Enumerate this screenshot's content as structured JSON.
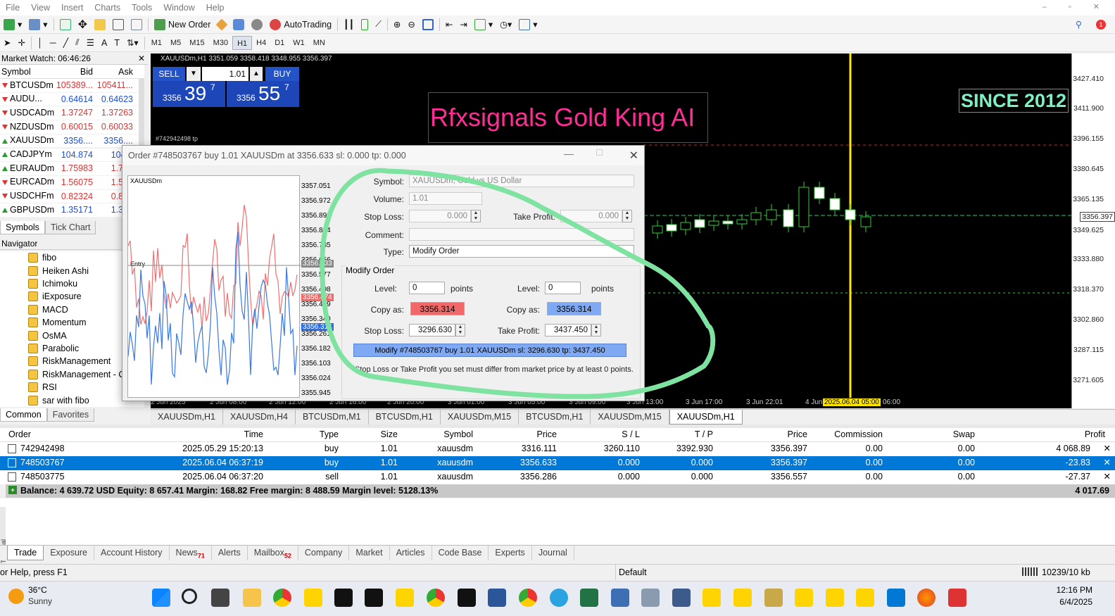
{
  "menu": [
    "File",
    "View",
    "Insert",
    "Charts",
    "Tools",
    "Window",
    "Help"
  ],
  "toolbar": {
    "new_order": "New Order",
    "autotrading": "AutoTrading"
  },
  "timeframes": [
    "M1",
    "M5",
    "M15",
    "M30",
    "H1",
    "H4",
    "D1",
    "W1",
    "MN"
  ],
  "active_timeframe": "H1",
  "market_watch": {
    "title": "Market Watch: 06:46:26",
    "cols": [
      "Symbol",
      "Bid",
      "Ask"
    ],
    "rows": [
      {
        "symbol": "BTCUSDm",
        "bid": "105389...",
        "ask": "105411...",
        "dir": "down",
        "color": "#d33"
      },
      {
        "symbol": "AUDU...",
        "bid": "0.64614",
        "ask": "0.64623",
        "dir": "down",
        "color": "#1a4fd6"
      },
      {
        "symbol": "USDCADm",
        "bid": "1.37247",
        "ask": "1.37263",
        "dir": "down",
        "color": "#d33"
      },
      {
        "symbol": "NZDUSDm",
        "bid": "0.60015",
        "ask": "0.60033",
        "dir": "down",
        "color": "#d33"
      },
      {
        "symbol": "XAUUSDm",
        "bid": "3356....",
        "ask": "3356....",
        "dir": "up",
        "color": "#1a4fd6"
      },
      {
        "symbol": "CADJPYm",
        "bid": "104.874",
        "ask": "104.9",
        "dir": "up",
        "color": "#1a4fd6"
      },
      {
        "symbol": "EURAUDm",
        "bid": "1.75983",
        "ask": "1.760",
        "dir": "up",
        "color": "#d33"
      },
      {
        "symbol": "EURCADm",
        "bid": "1.56075",
        "ask": "1.561",
        "dir": "down",
        "color": "#d33"
      },
      {
        "symbol": "USDCHFm",
        "bid": "0.82324",
        "ask": "0.823",
        "dir": "down",
        "color": "#d33"
      },
      {
        "symbol": "GBPUSDm",
        "bid": "1.35171",
        "ask": "1.351",
        "dir": "up",
        "color": "#1a4fd6"
      }
    ],
    "tabs": [
      "Symbols",
      "Tick Chart"
    ]
  },
  "navigator": {
    "title": "Navigator",
    "items": [
      "fibo",
      "Heiken Ashi",
      "Ichimoku",
      "iExposure",
      "MACD",
      "Momentum",
      "OsMA",
      "Parabolic",
      "RiskManagement",
      "RiskManagement - Co",
      "RSI",
      "sar with fibo"
    ],
    "tabs": [
      "Common",
      "Favorites"
    ]
  },
  "chart": {
    "header": "XAUUSDm,H1  3351.059 3358.418 3348.955 3356.397",
    "sell_label": "SELL",
    "buy_label": "BUY",
    "lot": "1.01",
    "sell_price_small": "3356",
    "sell_price_big": "39",
    "sell_price_sup": "7",
    "buy_price_small": "3356",
    "buy_price_big": "55",
    "buy_price_sup": "7",
    "banner": "Rfxsignals Gold King AI",
    "since": "SINCE 2012",
    "order_tag": "#742942498 tp",
    "y_ticks": [
      "3427.410",
      "3411.900",
      "3396.155",
      "3380.645",
      "3365.135",
      "3356.397",
      "3349.625",
      "3333.880",
      "3318.370",
      "3302.860",
      "3287.115",
      "3271.605"
    ],
    "x_ticks": [
      "2 Jun 2025",
      "2 Jun 08:00",
      "2 Jun 12:00",
      "2 Jun 16:00",
      "2 Jun 20:00",
      "3 Jun 01:00",
      "3 Jun 05:00",
      "3 Jun 09:00",
      "3 Jun 13:00",
      "3 Jun 17:00",
      "3 Jun 22:01",
      "4 Jun",
      "2025.06.04 05:00",
      "06:00"
    ],
    "tabs": [
      "XAUUSDm,H1",
      "XAUUSDm,H4",
      "BTCUSDm,M1",
      "BTCUSDm,H1",
      "XAUUSDm,M15",
      "BTCUSDm,H1",
      "XAUUSDm,M15",
      "XAUUSDm,H1"
    ],
    "active_tab_index": 7
  },
  "dialog": {
    "title": "Order #748503767 buy 1.01 XAUUSDm at 3356.633 sl: 0.000 tp: 0.000",
    "mini_chart_label": "XAUUSDm",
    "mini_entry": "Entry",
    "mini_ticks": [
      "3357.051",
      "3356.972",
      "3356.893",
      "3356.814",
      "3356.735",
      "3356.656",
      "3356.577",
      "3356.498",
      "3356.419",
      "3356.340",
      "3356.261",
      "3356.182",
      "3356.103",
      "3356.024",
      "3355.945"
    ],
    "mini_tag_gray": "3356.633",
    "mini_tag_red": "3356.474",
    "mini_tag_blue": "3356.314",
    "symbol_label": "Symbol:",
    "symbol_value": "XAUUSDm, Gold vs US Dollar",
    "volume_label": "Volume:",
    "volume_value": "1.01",
    "sl_label": "Stop Loss:",
    "sl_value": "0.000",
    "tp_label": "Take Profit:",
    "tp_value": "0.000",
    "comment_label": "Comment:",
    "type_label": "Type:",
    "type_value": "Modify Order",
    "group_label": "Modify Order",
    "level_label": "Level:",
    "level_value": "0",
    "points": "points",
    "copy_as": "Copy as:",
    "copy_sl": "3356.314",
    "copy_tp": "3356.314",
    "sl_label2": "Stop Loss:",
    "sl_value2": "3296.630",
    "tp_label2": "Take Profit:",
    "tp_value2": "3437.450",
    "modify_button": "Modify #748503767 buy 1.01 XAUUSDm sl: 3296.630 tp: 3437.450",
    "note": "Stop Loss or Take Profit you set must differ from market price by at least 0 points."
  },
  "trade": {
    "cols": [
      "Order",
      "Time",
      "Type",
      "Size",
      "Symbol",
      "Price",
      "S / L",
      "T / P",
      "Price",
      "Commission",
      "Swap",
      "Profit"
    ],
    "rows": [
      {
        "order": "742942498",
        "time": "2025.05.29 15:20:13",
        "type": "buy",
        "size": "1.01",
        "symbol": "xauusdm",
        "price": "3316.111",
        "sl": "3260.110",
        "tp": "3392.930",
        "cur": "3356.397",
        "comm": "0.00",
        "swap": "0.00",
        "profit": "4 068.89"
      },
      {
        "order": "748503767",
        "time": "2025.06.04 06:37:19",
        "type": "buy",
        "size": "1.01",
        "symbol": "xauusdm",
        "price": "3356.633",
        "sl": "0.000",
        "tp": "0.000",
        "cur": "3356.397",
        "comm": "0.00",
        "swap": "0.00",
        "profit": "-23.83"
      },
      {
        "order": "748503775",
        "time": "2025.06.04 06:37:20",
        "type": "sell",
        "size": "1.01",
        "symbol": "xauusdm",
        "price": "3356.286",
        "sl": "0.000",
        "tp": "0.000",
        "cur": "3356.557",
        "comm": "0.00",
        "swap": "0.00",
        "profit": "-27.37"
      }
    ],
    "balance": "Balance: 4 639.72 USD  Equity: 8 657.41  Margin: 168.82  Free margin: 8 488.59  Margin level: 5128.13%",
    "total": "4 017.69",
    "tabs": [
      {
        "label": "Trade",
        "badge": ""
      },
      {
        "label": "Exposure",
        "badge": ""
      },
      {
        "label": "Account History",
        "badge": ""
      },
      {
        "label": "News",
        "badge": "71"
      },
      {
        "label": "Alerts",
        "badge": ""
      },
      {
        "label": "Mailbox",
        "badge": "52"
      },
      {
        "label": "Company",
        "badge": ""
      },
      {
        "label": "Market",
        "badge": ""
      },
      {
        "label": "Articles",
        "badge": ""
      },
      {
        "label": "Code Base",
        "badge": ""
      },
      {
        "label": "Experts",
        "badge": ""
      },
      {
        "label": "Journal",
        "badge": ""
      }
    ],
    "side_label": "Terminal"
  },
  "status": {
    "help": "or Help, press F1",
    "profile": "Default",
    "traffic": "10239/10 kb"
  },
  "taskbar": {
    "temp": "36°C",
    "weather": "Sunny",
    "time": "12:16 PM",
    "date": "6/4/2025"
  }
}
